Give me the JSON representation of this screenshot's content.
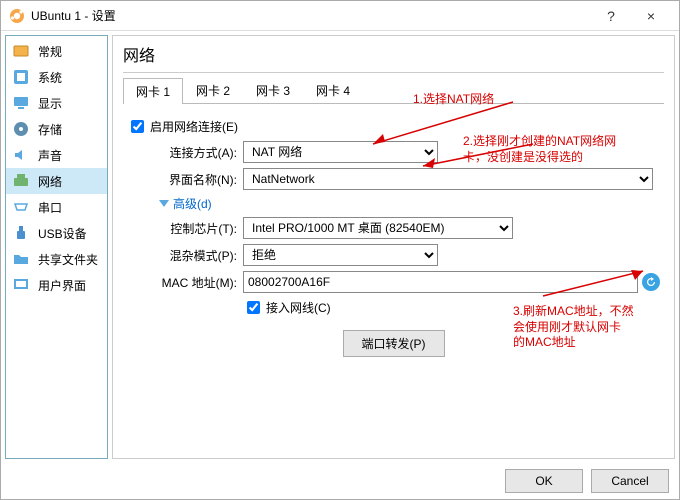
{
  "window": {
    "title": "UBuntu 1 - 设置",
    "help": "?",
    "close": "×"
  },
  "sidebar": {
    "items": [
      {
        "label": "常规"
      },
      {
        "label": "系统"
      },
      {
        "label": "显示"
      },
      {
        "label": "存储"
      },
      {
        "label": "声音"
      },
      {
        "label": "网络"
      },
      {
        "label": "串口"
      },
      {
        "label": "USB设备"
      },
      {
        "label": "共享文件夹"
      },
      {
        "label": "用户界面"
      }
    ]
  },
  "content": {
    "heading": "网络",
    "tabs": [
      "网卡 1",
      "网卡 2",
      "网卡 3",
      "网卡 4"
    ],
    "enable_label": "启用网络连接(E)",
    "conn_label": "连接方式(A):",
    "conn_value": "NAT 网络",
    "iface_label": "界面名称(N):",
    "iface_value": "NatNetwork",
    "advanced": "高级(d)",
    "ctrl_label": "控制芯片(T):",
    "ctrl_value": "Intel PRO/1000 MT 桌面 (82540EM)",
    "prom_label": "混杂模式(P):",
    "prom_value": "拒绝",
    "mac_label": "MAC 地址(M):",
    "mac_value": "08002700A16F",
    "cable_label": "接入网线(C)",
    "portfwd": "端口转发(P)"
  },
  "annotations": {
    "a1": "1.选择NAT网络",
    "a2": "2.选择刚才创建的NAT网络网\n卡，没创建是没得选的",
    "a3": "3.刷新MAC地址，不然\n会使用刚才默认网卡\n的MAC地址"
  },
  "buttons": {
    "ok": "OK",
    "cancel": "Cancel"
  }
}
